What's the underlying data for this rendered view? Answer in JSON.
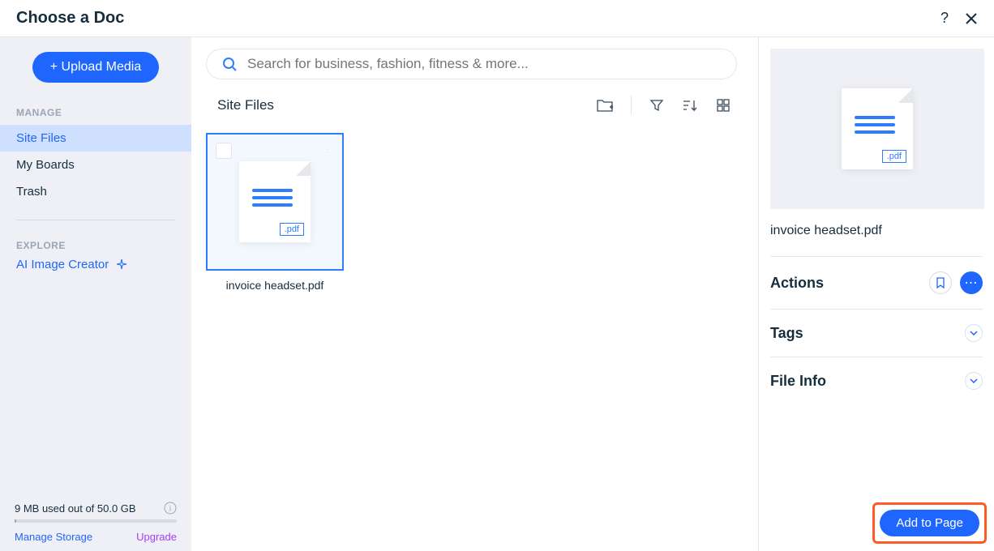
{
  "header": {
    "title": "Choose a Doc"
  },
  "sidebar": {
    "upload_label": "+ Upload Media",
    "manage_label": "MANAGE",
    "items": [
      {
        "label": "Site Files"
      },
      {
        "label": "My Boards"
      },
      {
        "label": "Trash"
      }
    ],
    "explore_label": "EXPLORE",
    "ai_label": "AI Image Creator",
    "storage_text": "9 MB used out of 50.0 GB",
    "manage_storage": "Manage Storage",
    "upgrade": "Upgrade"
  },
  "search": {
    "placeholder": "Search for business, fashion, fitness & more..."
  },
  "toolbar": {
    "title": "Site Files"
  },
  "files": [
    {
      "name": "invoice headset.pdf",
      "ext": ".pdf"
    }
  ],
  "details": {
    "filename": "invoice headset.pdf",
    "actions_label": "Actions",
    "tags_label": "Tags",
    "fileinfo_label": "File Info",
    "preview_ext": ".pdf"
  },
  "footer": {
    "add_label": "Add to Page"
  }
}
